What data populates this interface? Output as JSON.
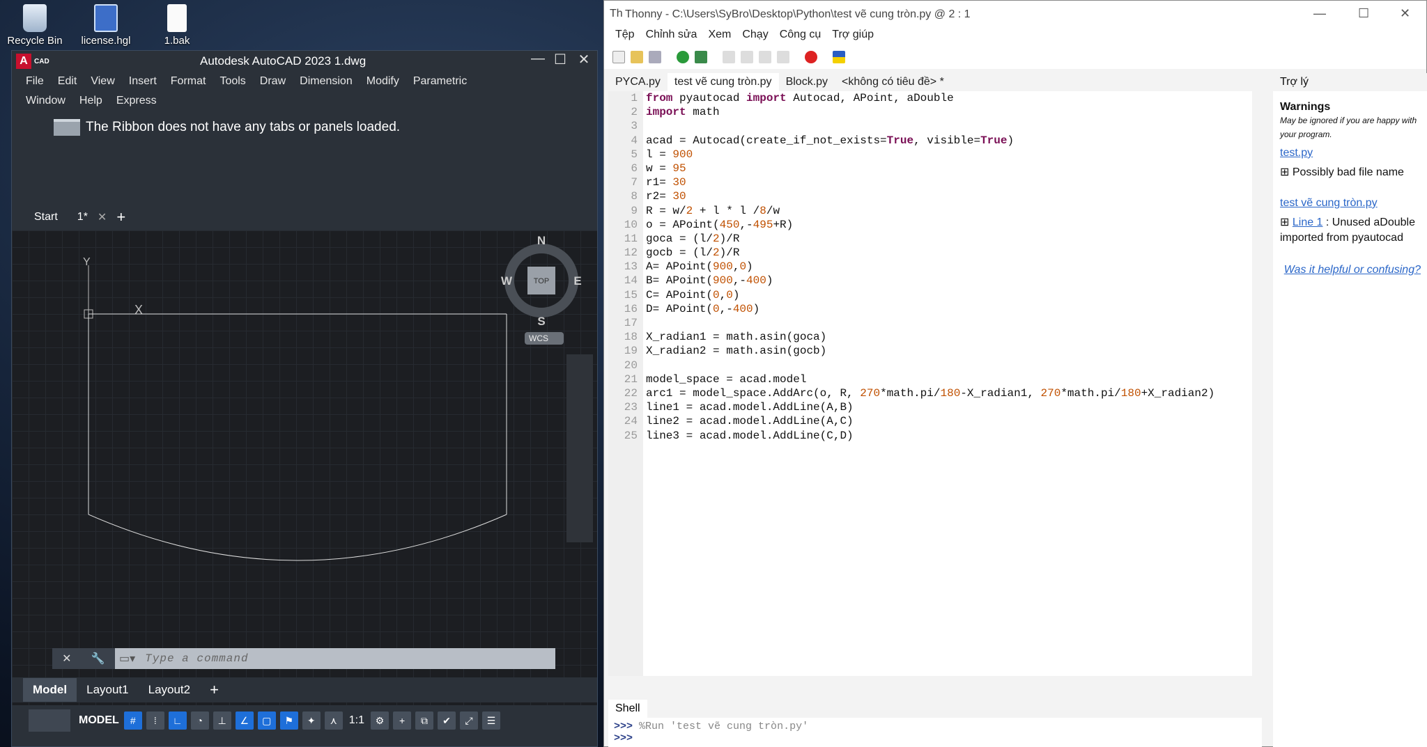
{
  "desktop": {
    "icons": [
      {
        "label": "Recycle Bin",
        "icon": "recycle-bin-icon"
      },
      {
        "label": "license.hgl",
        "icon": "document-icon"
      },
      {
        "label": "1.bak",
        "icon": "file-icon"
      }
    ]
  },
  "autocad": {
    "title": "Autodesk AutoCAD 2023    1.dwg",
    "logo_letter": "A",
    "logo_text": "CAD",
    "menu": [
      "File",
      "Edit",
      "View",
      "Insert",
      "Format",
      "Tools",
      "Draw",
      "Dimension",
      "Modify",
      "Parametric",
      "Window",
      "Help",
      "Express"
    ],
    "ribbon_message": "The Ribbon does not have any tabs or panels loaded.",
    "file_tabs": {
      "start": "Start",
      "current": "1*"
    },
    "viewcube": {
      "n": "N",
      "s": "S",
      "e": "E",
      "w": "W",
      "top": "TOP",
      "wcs": "WCS"
    },
    "ucs": {
      "x": "X",
      "y": "Y"
    },
    "command_placeholder": "Type a command",
    "layout_tabs": [
      "Model",
      "Layout1",
      "Layout2"
    ],
    "status": {
      "model": "MODEL",
      "scale": "1:1"
    }
  },
  "thonny": {
    "title": "Thonny  -  C:\\Users\\SyBro\\Desktop\\Python\\test vẽ cung tròn.py  @  2 : 1",
    "menu": [
      "Tệp",
      "Chỉnh sửa",
      "Xem",
      "Chạy",
      "Công cụ",
      "Trợ giúp"
    ],
    "tabs": [
      "PYCA.py",
      "test vẽ cung tròn.py",
      "Block.py",
      "<không có tiêu đề> *"
    ],
    "code_lines": [
      "from pyautocad import Autocad, APoint, aDouble",
      "import math",
      "",
      "acad = Autocad(create_if_not_exists=True, visible=True)",
      "l = 900",
      "w = 95",
      "r1= 30",
      "r2= 30",
      "R = w/2 + l * l /8/w",
      "o = APoint(450,-495+R)",
      "goca = (l/2)/R",
      "gocb = (l/2)/R",
      "A= APoint(900,0)",
      "B= APoint(900,-400)",
      "C= APoint(0,0)",
      "D= APoint(0,-400)",
      "",
      "X_radian1 = math.asin(goca)",
      "X_radian2 = math.asin(gocb)",
      "",
      "model_space = acad.model",
      "arc1 = model_space.AddArc(o, R, 270*math.pi/180-X_radian1, 270*math.pi/180+X_radian2)",
      "line1 = acad.model.AddLine(A,B)",
      "line2 = acad.model.AddLine(A,C)",
      "line3 = acad.model.AddLine(C,D)"
    ],
    "assistant": {
      "tab": "Trợ lý",
      "warnings_title": "Warnings",
      "warnings_sub": "May be ignored if you are happy with your program.",
      "file1": "test.py",
      "file1_msg": "Possibly bad file name",
      "file2": "test vẽ cung tròn.py",
      "file2_link": "Line 1",
      "file2_msg": ": Unused aDouble imported from pyautocad",
      "feedback": "Was it helpful or confusing?"
    },
    "shell": {
      "tab": "Shell",
      "prompt": ">>>",
      "run": "%Run 'test vẽ cung tròn.py'"
    }
  }
}
